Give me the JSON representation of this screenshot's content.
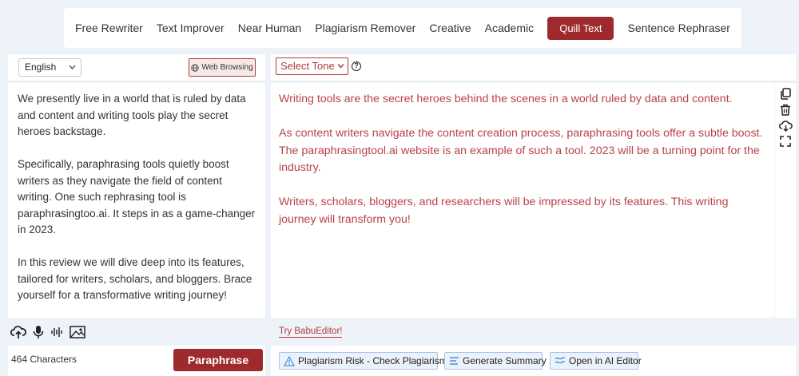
{
  "modes": {
    "items": [
      {
        "label": "Free Rewriter"
      },
      {
        "label": "Text Improver"
      },
      {
        "label": "Near Human"
      },
      {
        "label": "Plagiarism Remover"
      },
      {
        "label": "Creative"
      },
      {
        "label": "Academic"
      },
      {
        "label": "Quill Text"
      },
      {
        "label": "Sentence Rephraser"
      }
    ],
    "active": "Quill Text"
  },
  "input": {
    "language": "English",
    "web_browsing_label": "Web Browsing",
    "paragraphs": [
      "We presently live in a world that is ruled by data and content and writing tools play the secret heroes backstage.",
      "Specifically, paraphrasing tools quietly boost writers as they navigate the field of content writing. One such rephrasing tool is paraphrasingtoo.ai. It steps in as a game-changer in 2023.",
      "In this review we will dive deep into its features, tailored for writers, scholars, and bloggers. Brace yourself for a transformative writing journey!"
    ],
    "char_count": "464 Characters",
    "paraphrase_label": "Paraphrase"
  },
  "output": {
    "tone_label": "Select Tone",
    "help_glyph": "?",
    "paragraphs": [
      "Writing tools are the secret heroes behind the scenes in a world ruled by data and content.",
      "As content writers navigate the content creation process, paraphrasing tools offer a subtle boost. The paraphrasingtool.ai website is an example of such a tool. 2023 will be a turning point for the industry.",
      "Writers, scholars, bloggers, and researchers will be impressed by its features. This writing journey will transform you!"
    ],
    "try_link": "Try BabuEditor!",
    "actions": {
      "plagiarism": "Plagiarism Risk - Check Plagiarism",
      "summary": "Generate Summary",
      "ai_editor": "Open in AI Editor"
    }
  },
  "colors": {
    "accent": "#9e2a2e",
    "output_text": "#b8414a",
    "background": "#eef3f9"
  },
  "icons": {
    "left_tools": [
      "upload-cloud-icon",
      "microphone-icon",
      "audio-wave-icon",
      "image-icon"
    ],
    "side": [
      "copy-icon",
      "trash-icon",
      "download-cloud-icon",
      "fullscreen-icon"
    ]
  }
}
